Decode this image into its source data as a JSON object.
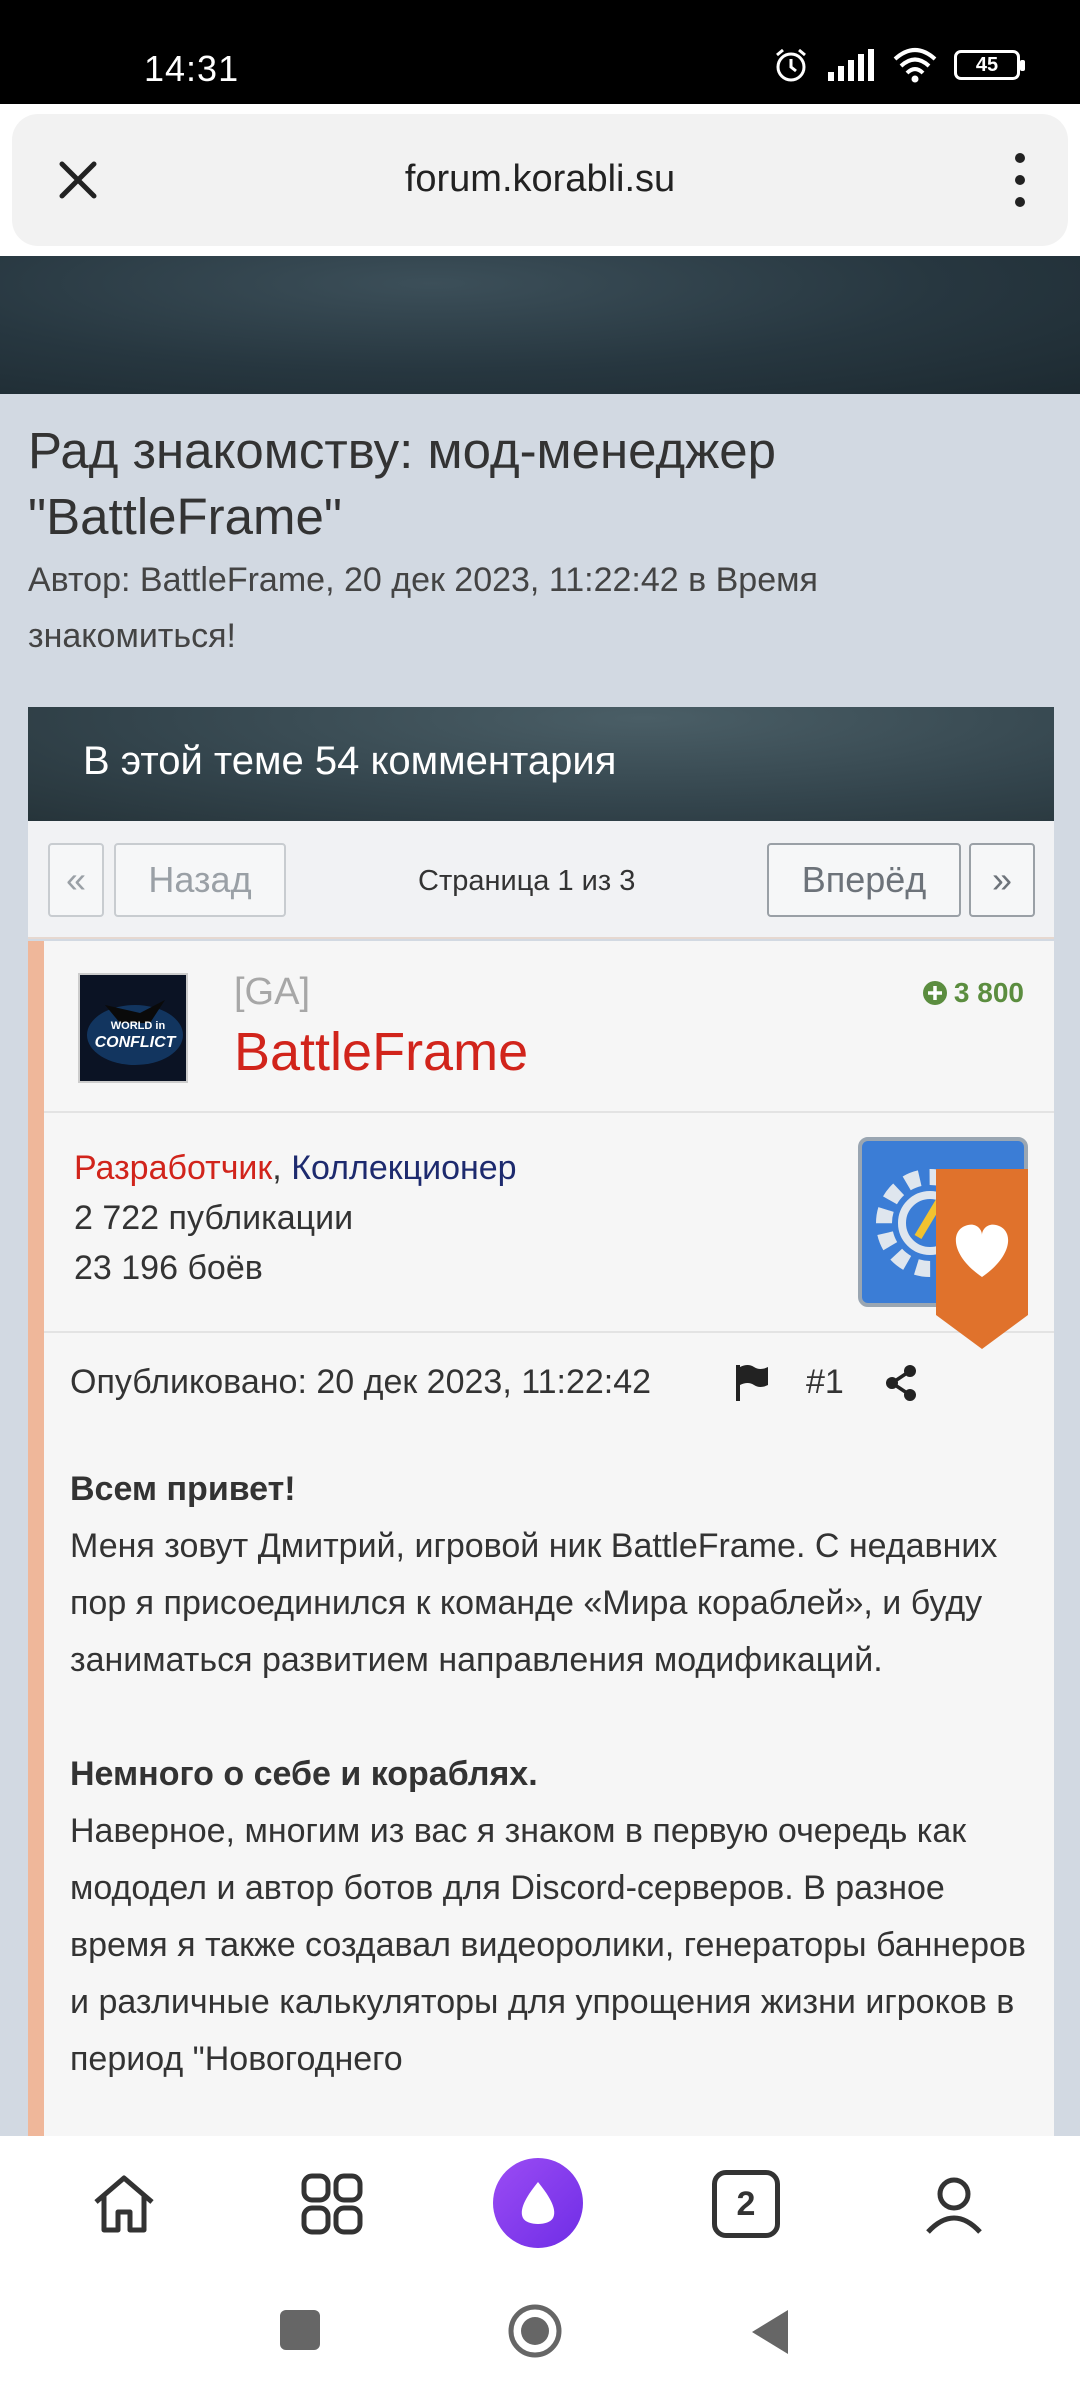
{
  "status_bar": {
    "time": "14:31",
    "battery": "45"
  },
  "browser": {
    "url": "forum.korabli.su"
  },
  "topic": {
    "title": "Рад знакомству: мод-менеджер \"BattleFrame\"",
    "meta": "Автор: BattleFrame, 20 дек 2023, 11:22:42 в Время знакомиться!"
  },
  "comments_header": "В этой теме 54 комментария",
  "pagination": {
    "first": "«",
    "prev": "Назад",
    "info": "Страница 1 из 3",
    "next": "Вперёд",
    "last": "»"
  },
  "post": {
    "clan": "[GA]",
    "username": "BattleFrame",
    "reputation": "3 800",
    "role_1": "Разработчик",
    "role_sep": ",",
    "role_2": "Коллекционер",
    "publications": "2 722 публикации",
    "battles": "23 196 боёв",
    "avatar_text_1": "WORLD in",
    "avatar_text_2": "CONFLICT",
    "published": "Опубликовано: 20 дек 2023, 11:22:42",
    "number": "#1",
    "p1_heading": "Всем привет!",
    "p1_text": "Меня зовут Дмитрий, игровой ник BattleFrame. С недавних пор я присоединился к команде «Мира кораблей», и буду заниматься развитием направления модификаций.",
    "p2_heading": "Немного о себе и кораблях.",
    "p2_text": "Наверное, многим из вас я знаком в первую очередь как мододел и автор ботов для Discord-серверов. В разное время я также создавал видеоролики, генераторы баннеров и различные калькуляторы для упрощения жизни игроков в период \"Новогоднего"
  },
  "colors": {
    "accent_red": "#d1241b",
    "role_blue": "#1d2a6e",
    "rep_green": "#5b8d3f",
    "like_orange": "#e0722c",
    "post_border": "#efb79a",
    "alice_purple": "#7b35ea"
  },
  "icons": {
    "close": "close-icon",
    "menu": "more-vert-icon",
    "flag": "flag-icon",
    "share": "share-icon",
    "home": "home-icon",
    "apps": "apps-grid-icon",
    "assistant": "alice-assistant-icon",
    "tabs": "tabs-count-icon",
    "profile": "profile-icon"
  },
  "bottom_nav": {
    "tabs_count": "2"
  }
}
